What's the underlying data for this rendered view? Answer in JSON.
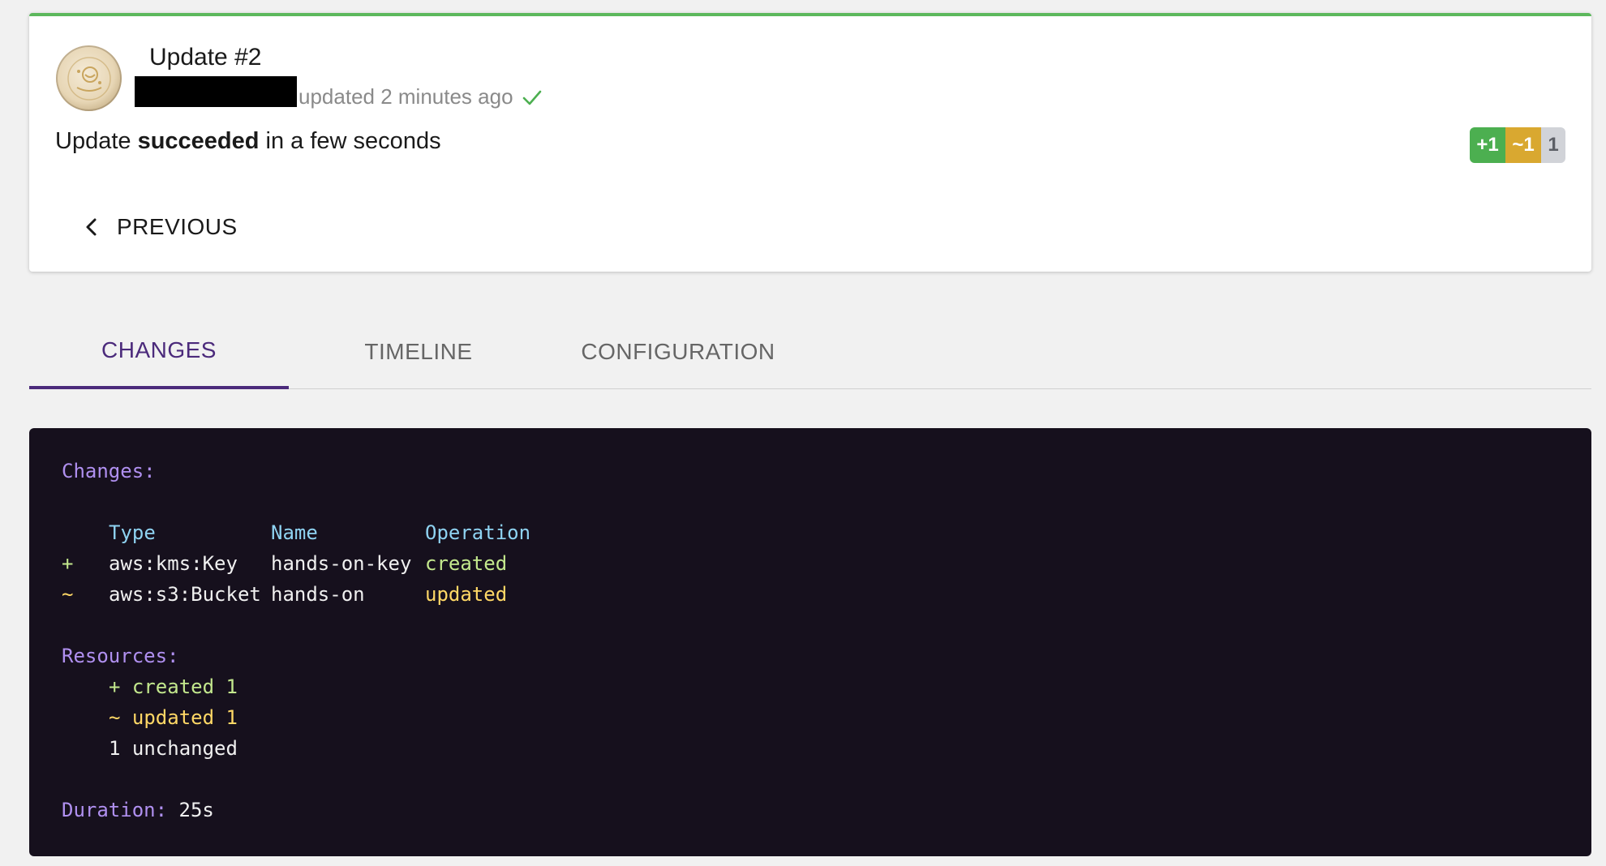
{
  "update": {
    "title": "Update #2",
    "meta_text": "updated 2 minutes ago",
    "summary_prefix": "Update ",
    "summary_status": "succeeded",
    "summary_suffix": " in a few seconds",
    "counts": {
      "created": "+1",
      "updated": "~1",
      "unchanged": "1"
    },
    "previous_label": "PREVIOUS"
  },
  "colors": {
    "success_accent": "#5cb85c",
    "tab_active": "#4b2a7b",
    "terminal_bg": "#16101d"
  },
  "tabs": [
    {
      "label": "CHANGES",
      "active": true
    },
    {
      "label": "TIMELINE",
      "active": false
    },
    {
      "label": "CONFIGURATION",
      "active": false
    }
  ],
  "output": {
    "changes_header": "Changes:",
    "columns": {
      "type": "Type",
      "name": "Name",
      "operation": "Operation"
    },
    "rows": [
      {
        "symbol": "+",
        "type": "aws:kms:Key",
        "name": "hands-on-key",
        "operation": "created"
      },
      {
        "symbol": "~",
        "type": "aws:s3:Bucket",
        "name": "hands-on",
        "operation": "updated"
      }
    ],
    "resources_header": "Resources:",
    "resources": {
      "created": "+ created 1",
      "updated": "~ updated 1",
      "unchanged": "1 unchanged"
    },
    "duration_label": "Duration:",
    "duration_value": "25s"
  },
  "icons": {
    "avatar": "avatar-image",
    "check": "check-icon",
    "previous": "chevron-left-icon"
  }
}
